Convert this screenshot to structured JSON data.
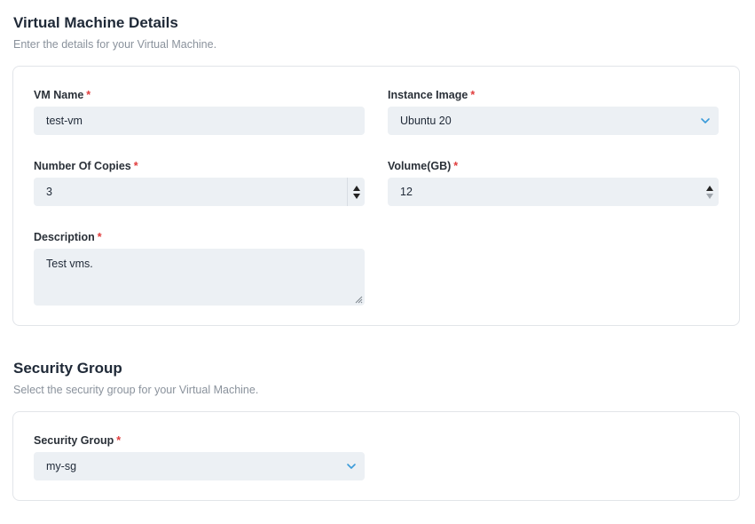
{
  "vm_section": {
    "title": "Virtual Machine Details",
    "subtitle": "Enter the details for your Virtual Machine.",
    "vm_name": {
      "label": "VM Name",
      "required": "*",
      "value": "test-vm"
    },
    "instance_image": {
      "label": "Instance Image",
      "required": "*",
      "value": "Ubuntu 20",
      "icon": "chevron-down-icon"
    },
    "copies": {
      "label": "Number Of Copies",
      "required": "*",
      "value": "3"
    },
    "volume": {
      "label": "Volume(GB)",
      "required": "*",
      "value": "12"
    },
    "description": {
      "label": "Description",
      "required": "*",
      "value": "Test vms."
    }
  },
  "security_section": {
    "title": "Security Group",
    "subtitle": "Select the security group for your Virtual Machine.",
    "security_group": {
      "label": "Security Group",
      "required": "*",
      "value": "my-sg",
      "icon": "chevron-down-icon"
    }
  },
  "colors": {
    "required": "#e03c3c",
    "chevron": "#3a9bd9",
    "field_bg": "#ecf0f4"
  }
}
